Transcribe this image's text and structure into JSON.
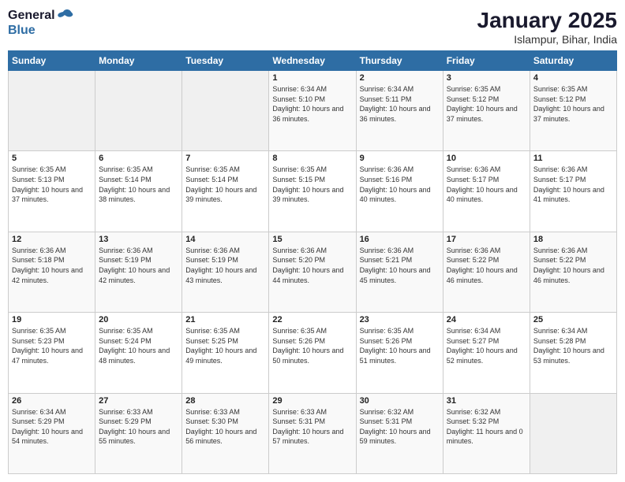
{
  "logo": {
    "line1": "General",
    "line2": "Blue"
  },
  "title": "January 2025",
  "location": "Islampur, Bihar, India",
  "weekdays": [
    "Sunday",
    "Monday",
    "Tuesday",
    "Wednesday",
    "Thursday",
    "Friday",
    "Saturday"
  ],
  "weeks": [
    [
      {
        "num": "",
        "sunrise": "",
        "sunset": "",
        "daylight": "",
        "empty": true
      },
      {
        "num": "",
        "sunrise": "",
        "sunset": "",
        "daylight": "",
        "empty": true
      },
      {
        "num": "",
        "sunrise": "",
        "sunset": "",
        "daylight": "",
        "empty": true
      },
      {
        "num": "1",
        "sunrise": "Sunrise: 6:34 AM",
        "sunset": "Sunset: 5:10 PM",
        "daylight": "Daylight: 10 hours and 36 minutes.",
        "empty": false
      },
      {
        "num": "2",
        "sunrise": "Sunrise: 6:34 AM",
        "sunset": "Sunset: 5:11 PM",
        "daylight": "Daylight: 10 hours and 36 minutes.",
        "empty": false
      },
      {
        "num": "3",
        "sunrise": "Sunrise: 6:35 AM",
        "sunset": "Sunset: 5:12 PM",
        "daylight": "Daylight: 10 hours and 37 minutes.",
        "empty": false
      },
      {
        "num": "4",
        "sunrise": "Sunrise: 6:35 AM",
        "sunset": "Sunset: 5:12 PM",
        "daylight": "Daylight: 10 hours and 37 minutes.",
        "empty": false
      }
    ],
    [
      {
        "num": "5",
        "sunrise": "Sunrise: 6:35 AM",
        "sunset": "Sunset: 5:13 PM",
        "daylight": "Daylight: 10 hours and 37 minutes.",
        "empty": false
      },
      {
        "num": "6",
        "sunrise": "Sunrise: 6:35 AM",
        "sunset": "Sunset: 5:14 PM",
        "daylight": "Daylight: 10 hours and 38 minutes.",
        "empty": false
      },
      {
        "num": "7",
        "sunrise": "Sunrise: 6:35 AM",
        "sunset": "Sunset: 5:14 PM",
        "daylight": "Daylight: 10 hours and 39 minutes.",
        "empty": false
      },
      {
        "num": "8",
        "sunrise": "Sunrise: 6:35 AM",
        "sunset": "Sunset: 5:15 PM",
        "daylight": "Daylight: 10 hours and 39 minutes.",
        "empty": false
      },
      {
        "num": "9",
        "sunrise": "Sunrise: 6:36 AM",
        "sunset": "Sunset: 5:16 PM",
        "daylight": "Daylight: 10 hours and 40 minutes.",
        "empty": false
      },
      {
        "num": "10",
        "sunrise": "Sunrise: 6:36 AM",
        "sunset": "Sunset: 5:17 PM",
        "daylight": "Daylight: 10 hours and 40 minutes.",
        "empty": false
      },
      {
        "num": "11",
        "sunrise": "Sunrise: 6:36 AM",
        "sunset": "Sunset: 5:17 PM",
        "daylight": "Daylight: 10 hours and 41 minutes.",
        "empty": false
      }
    ],
    [
      {
        "num": "12",
        "sunrise": "Sunrise: 6:36 AM",
        "sunset": "Sunset: 5:18 PM",
        "daylight": "Daylight: 10 hours and 42 minutes.",
        "empty": false
      },
      {
        "num": "13",
        "sunrise": "Sunrise: 6:36 AM",
        "sunset": "Sunset: 5:19 PM",
        "daylight": "Daylight: 10 hours and 42 minutes.",
        "empty": false
      },
      {
        "num": "14",
        "sunrise": "Sunrise: 6:36 AM",
        "sunset": "Sunset: 5:19 PM",
        "daylight": "Daylight: 10 hours and 43 minutes.",
        "empty": false
      },
      {
        "num": "15",
        "sunrise": "Sunrise: 6:36 AM",
        "sunset": "Sunset: 5:20 PM",
        "daylight": "Daylight: 10 hours and 44 minutes.",
        "empty": false
      },
      {
        "num": "16",
        "sunrise": "Sunrise: 6:36 AM",
        "sunset": "Sunset: 5:21 PM",
        "daylight": "Daylight: 10 hours and 45 minutes.",
        "empty": false
      },
      {
        "num": "17",
        "sunrise": "Sunrise: 6:36 AM",
        "sunset": "Sunset: 5:22 PM",
        "daylight": "Daylight: 10 hours and 46 minutes.",
        "empty": false
      },
      {
        "num": "18",
        "sunrise": "Sunrise: 6:36 AM",
        "sunset": "Sunset: 5:22 PM",
        "daylight": "Daylight: 10 hours and 46 minutes.",
        "empty": false
      }
    ],
    [
      {
        "num": "19",
        "sunrise": "Sunrise: 6:35 AM",
        "sunset": "Sunset: 5:23 PM",
        "daylight": "Daylight: 10 hours and 47 minutes.",
        "empty": false
      },
      {
        "num": "20",
        "sunrise": "Sunrise: 6:35 AM",
        "sunset": "Sunset: 5:24 PM",
        "daylight": "Daylight: 10 hours and 48 minutes.",
        "empty": false
      },
      {
        "num": "21",
        "sunrise": "Sunrise: 6:35 AM",
        "sunset": "Sunset: 5:25 PM",
        "daylight": "Daylight: 10 hours and 49 minutes.",
        "empty": false
      },
      {
        "num": "22",
        "sunrise": "Sunrise: 6:35 AM",
        "sunset": "Sunset: 5:26 PM",
        "daylight": "Daylight: 10 hours and 50 minutes.",
        "empty": false
      },
      {
        "num": "23",
        "sunrise": "Sunrise: 6:35 AM",
        "sunset": "Sunset: 5:26 PM",
        "daylight": "Daylight: 10 hours and 51 minutes.",
        "empty": false
      },
      {
        "num": "24",
        "sunrise": "Sunrise: 6:34 AM",
        "sunset": "Sunset: 5:27 PM",
        "daylight": "Daylight: 10 hours and 52 minutes.",
        "empty": false
      },
      {
        "num": "25",
        "sunrise": "Sunrise: 6:34 AM",
        "sunset": "Sunset: 5:28 PM",
        "daylight": "Daylight: 10 hours and 53 minutes.",
        "empty": false
      }
    ],
    [
      {
        "num": "26",
        "sunrise": "Sunrise: 6:34 AM",
        "sunset": "Sunset: 5:29 PM",
        "daylight": "Daylight: 10 hours and 54 minutes.",
        "empty": false
      },
      {
        "num": "27",
        "sunrise": "Sunrise: 6:33 AM",
        "sunset": "Sunset: 5:29 PM",
        "daylight": "Daylight: 10 hours and 55 minutes.",
        "empty": false
      },
      {
        "num": "28",
        "sunrise": "Sunrise: 6:33 AM",
        "sunset": "Sunset: 5:30 PM",
        "daylight": "Daylight: 10 hours and 56 minutes.",
        "empty": false
      },
      {
        "num": "29",
        "sunrise": "Sunrise: 6:33 AM",
        "sunset": "Sunset: 5:31 PM",
        "daylight": "Daylight: 10 hours and 57 minutes.",
        "empty": false
      },
      {
        "num": "30",
        "sunrise": "Sunrise: 6:32 AM",
        "sunset": "Sunset: 5:31 PM",
        "daylight": "Daylight: 10 hours and 59 minutes.",
        "empty": false
      },
      {
        "num": "31",
        "sunrise": "Sunrise: 6:32 AM",
        "sunset": "Sunset: 5:32 PM",
        "daylight": "Daylight: 11 hours and 0 minutes.",
        "empty": false
      },
      {
        "num": "",
        "sunrise": "",
        "sunset": "",
        "daylight": "",
        "empty": true
      }
    ]
  ]
}
